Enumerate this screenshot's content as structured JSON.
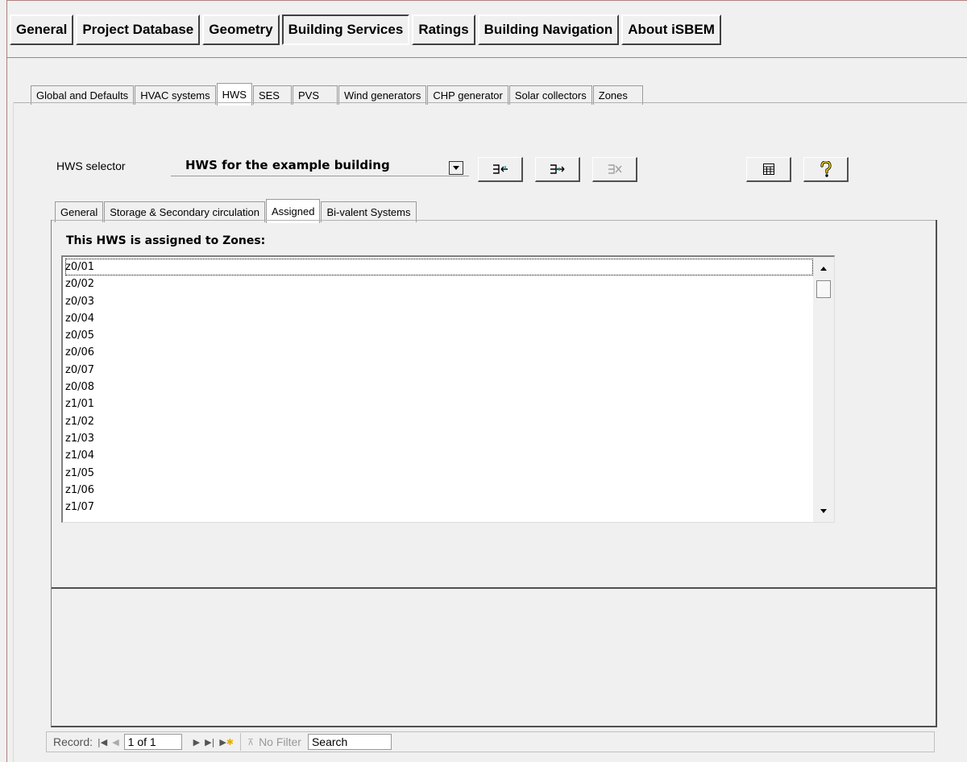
{
  "main_tabs": [
    {
      "label": "General"
    },
    {
      "label": "Project Database"
    },
    {
      "label": "Geometry"
    },
    {
      "label": "Building Services"
    },
    {
      "label": "Ratings"
    },
    {
      "label": "Building Navigation"
    },
    {
      "label": "About iSBEM"
    }
  ],
  "sub_tabs": [
    {
      "label": "Global and Defaults"
    },
    {
      "label": "HVAC systems"
    },
    {
      "label": "HWS"
    },
    {
      "label": "SES"
    },
    {
      "label": "PVS"
    },
    {
      "label": "Wind generators"
    },
    {
      "label": "CHP generator"
    },
    {
      "label": "Solar collectors"
    },
    {
      "label": "Zones"
    }
  ],
  "selector": {
    "label": "HWS selector",
    "value": "HWS for the example building"
  },
  "toolbar_icons": [
    "add-record-icon",
    "copy-record-icon",
    "delete-record-icon",
    "table-view-icon",
    "help-icon"
  ],
  "inner_tabs": [
    {
      "label": "General"
    },
    {
      "label": "Storage & Secondary circulation"
    },
    {
      "label": "Assigned"
    },
    {
      "label": "Bi-valent Systems"
    }
  ],
  "assigned": {
    "title": "This HWS is assigned to Zones:",
    "zones": [
      "z0/01",
      "z0/02",
      "z0/03",
      "z0/04",
      "z0/05",
      "z0/06",
      "z0/07",
      "z0/08",
      "z1/01",
      "z1/02",
      "z1/03",
      "z1/04",
      "z1/05",
      "z1/06",
      "z1/07"
    ]
  },
  "navigator": {
    "record_label": "Record:",
    "record_value": "1 of 1",
    "filter_label": "No Filter",
    "search_label": "Search"
  }
}
